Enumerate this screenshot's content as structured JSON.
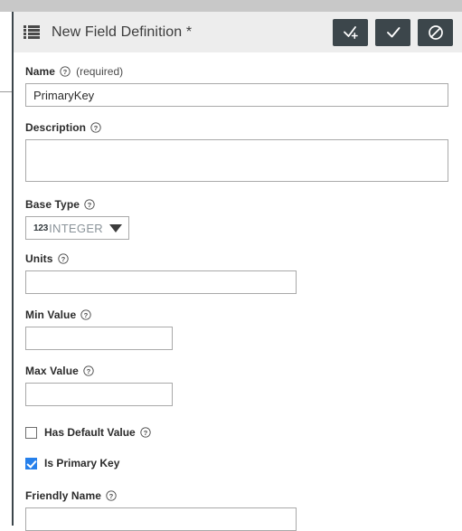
{
  "window": {
    "top_strip_color": "#c8c8c8",
    "panel_background": "#ffffff"
  },
  "header": {
    "icon": "list-icon",
    "title": "New Field Definition *",
    "background": "#ededed",
    "button_color": "#3c464b",
    "actions": [
      {
        "name": "save-and-add-button",
        "icon": "check-plus-icon"
      },
      {
        "name": "save-button",
        "icon": "check-icon"
      },
      {
        "name": "cancel-button",
        "icon": "block-icon"
      }
    ]
  },
  "form": {
    "help_icon": "question-circle-icon",
    "name": {
      "label": "Name",
      "required_note": "(required)",
      "value": "PrimaryKey",
      "placeholder": ""
    },
    "description": {
      "label": "Description",
      "value": "",
      "placeholder": ""
    },
    "base_type": {
      "label": "Base Type",
      "type_prefix": "123",
      "value": "INTEGER",
      "caret": "chevron-down-icon"
    },
    "units": {
      "label": "Units",
      "value": "",
      "placeholder": ""
    },
    "min_value": {
      "label": "Min Value",
      "value": "",
      "placeholder": ""
    },
    "max_value": {
      "label": "Max Value",
      "value": "",
      "placeholder": ""
    },
    "has_default_value": {
      "label": "Has Default Value",
      "checked": false
    },
    "is_primary_key": {
      "label": "Is Primary Key",
      "checked": true,
      "accent_color": "#2680eb"
    },
    "friendly_name": {
      "label": "Friendly Name",
      "value": "",
      "placeholder": ""
    }
  }
}
